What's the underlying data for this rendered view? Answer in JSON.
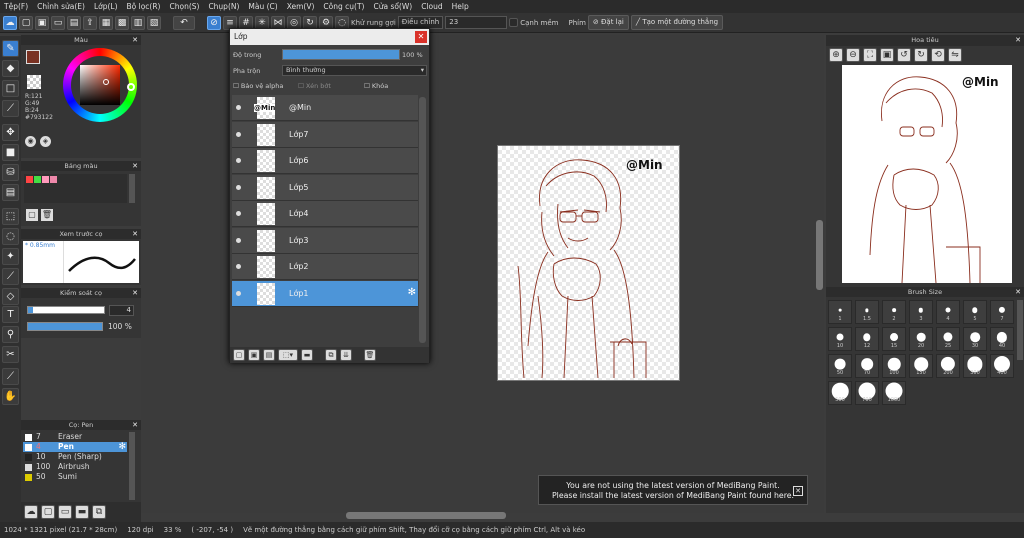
{
  "menu": [
    "Tệp(F)",
    "Chỉnh sửa(E)",
    "Lớp(L)",
    "Bộ lọc(R)",
    "Chọn(S)",
    "Chụp(N)",
    "Màu (C)",
    "Xem(V)",
    "Công cụ(T)",
    "Cửa sổ(W)",
    "Cloud",
    "Help"
  ],
  "toolbar": {
    "shake_label": "Khử rung gợi",
    "adjust_value": "Điều chỉnh",
    "adjust_num": "23",
    "edge_label": "Cạnh mềm",
    "key_label": "Phím",
    "reset_label": "Đặt lại",
    "line_label": "Tạo một đường thẳng"
  },
  "color_panel": {
    "title": "Màu",
    "r": "R:121",
    "g": "G:49",
    "b": "B:24",
    "hex": "#793122",
    "primary": "#793122"
  },
  "palette_panel": {
    "title": "Bảng màu",
    "swatches": [
      "#ff4444",
      "#44dd44",
      "#ff99bb",
      "#ee88aa"
    ]
  },
  "brush_preview": {
    "title": "Xem trước cọ",
    "size": "0.85mm"
  },
  "brush_control": {
    "title": "Kiểm soát cọ",
    "size_value": "4",
    "opacity_value": "100 %",
    "opacity_level": 1.0
  },
  "brush_list": {
    "title": "Cọ: Pen",
    "items": [
      {
        "size": "7",
        "name": "Eraser",
        "color": "#ffffff"
      },
      {
        "size": "4",
        "name": "Pen",
        "color": "#ffffff"
      },
      {
        "size": "10",
        "name": "Pen (Sharp)",
        "color": "#222222"
      },
      {
        "size": "100",
        "name": "Airbrush",
        "color": "#dddddd"
      },
      {
        "size": "50",
        "name": "Sumi",
        "color": "#ddcc00"
      }
    ]
  },
  "layers": {
    "title": "Lớp",
    "opacity_label": "Độ trong",
    "opacity_value": "100 %",
    "opacity_level": 1.0,
    "blend_label": "Pha trộn",
    "blend_value": "Bình thường",
    "protect_alpha": "Bảo vệ alpha",
    "clip": "Xén bớt",
    "lock": "Khóa",
    "items": [
      {
        "name": "@Min",
        "thumb_text": "@Min"
      },
      {
        "name": "Lớp7"
      },
      {
        "name": "Lớp6"
      },
      {
        "name": "Lớp5"
      },
      {
        "name": "Lớp4"
      },
      {
        "name": "Lớp3"
      },
      {
        "name": "Lớp2"
      },
      {
        "name": "Lớp1"
      }
    ],
    "selected": "Lớp1"
  },
  "canvas": {
    "watermark": "@Min"
  },
  "navigator": {
    "title": "Hoa tiêu",
    "watermark": "@Min"
  },
  "brush_size": {
    "title": "Brush Size",
    "sizes": [
      "1",
      "1.5",
      "2",
      "3",
      "4",
      "5",
      "7",
      "10",
      "12",
      "15",
      "20",
      "25",
      "30",
      "40",
      "50",
      "70",
      "100",
      "150",
      "200",
      "300",
      "400",
      "500",
      "700",
      "1000"
    ]
  },
  "notice": {
    "line1": "You are not using the latest version of MediBang Paint.",
    "line2": "Please install the latest version of MediBang Paint found here."
  },
  "status": {
    "dimensions": "1024 * 1321 pixel",
    "physical": "(21.7 * 28cm)",
    "dpi": "120 dpi",
    "zoom": "33 %",
    "coords": "( -207, -54 )",
    "hint": "Vẽ một đường thẳng bằng cách giữ phím Shift, Thay đổi cỡ cọ bằng cách giữ phím Ctrl, Alt và kéo"
  }
}
